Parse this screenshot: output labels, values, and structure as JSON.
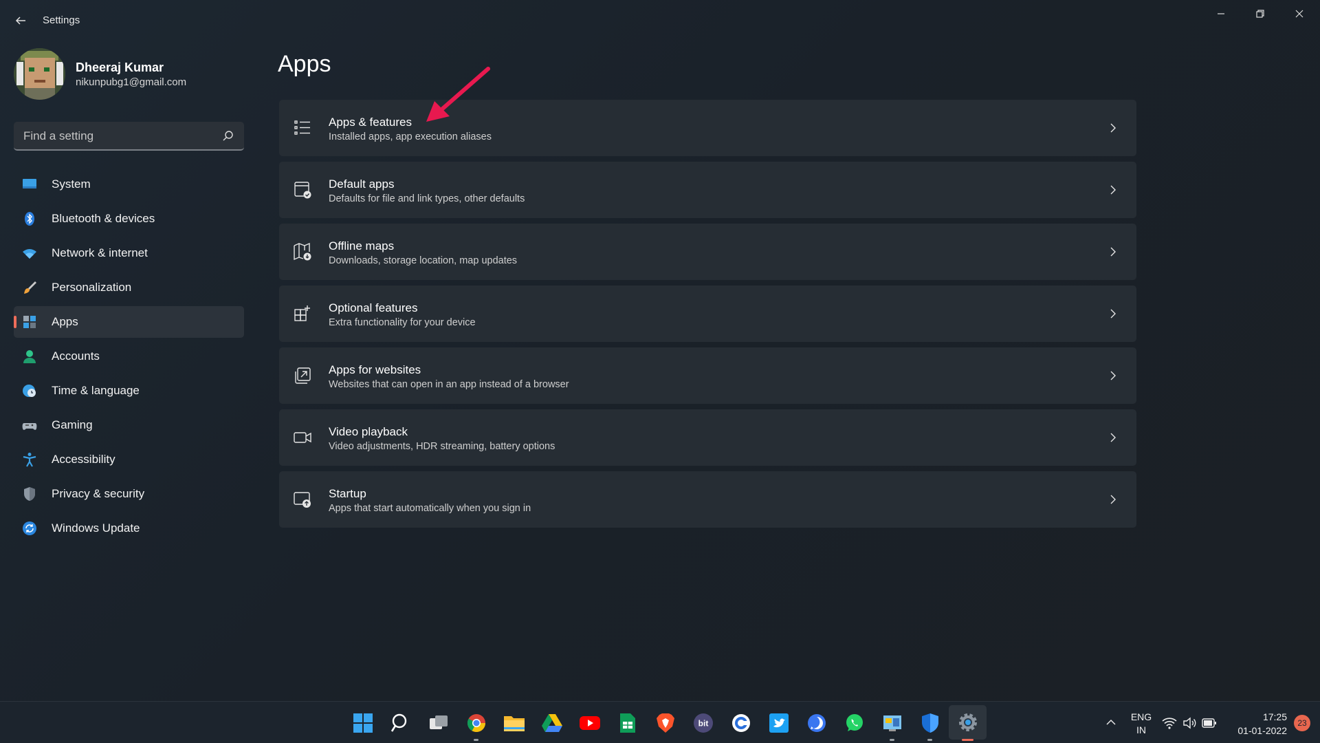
{
  "window": {
    "title": "Settings",
    "controls": [
      "minimize",
      "restore",
      "close"
    ]
  },
  "profile": {
    "name": "Dheeraj Kumar",
    "email": "nikunpubg1@gmail.com"
  },
  "search": {
    "placeholder": "Find a setting"
  },
  "sidebar": {
    "active": "Apps",
    "items": [
      {
        "label": "System",
        "icon": "monitor-icon"
      },
      {
        "label": "Bluetooth & devices",
        "icon": "bluetooth-icon"
      },
      {
        "label": "Network & internet",
        "icon": "wifi-icon"
      },
      {
        "label": "Personalization",
        "icon": "brush-icon"
      },
      {
        "label": "Apps",
        "icon": "apps-icon"
      },
      {
        "label": "Accounts",
        "icon": "person-icon"
      },
      {
        "label": "Time & language",
        "icon": "globe-clock-icon"
      },
      {
        "label": "Gaming",
        "icon": "gamepad-icon"
      },
      {
        "label": "Accessibility",
        "icon": "accessibility-icon"
      },
      {
        "label": "Privacy & security",
        "icon": "shield-icon"
      },
      {
        "label": "Windows Update",
        "icon": "update-icon"
      }
    ]
  },
  "main": {
    "title": "Apps",
    "cards": [
      {
        "title": "Apps & features",
        "subtitle": "Installed apps, app execution aliases",
        "icon": "list-icon"
      },
      {
        "title": "Default apps",
        "subtitle": "Defaults for file and link types, other defaults",
        "icon": "default-apps-icon"
      },
      {
        "title": "Offline maps",
        "subtitle": "Downloads, storage location, map updates",
        "icon": "map-icon"
      },
      {
        "title": "Optional features",
        "subtitle": "Extra functionality for your device",
        "icon": "grid-plus-icon"
      },
      {
        "title": "Apps for websites",
        "subtitle": "Websites that can open in an app instead of a browser",
        "icon": "open-external-icon"
      },
      {
        "title": "Video playback",
        "subtitle": "Video adjustments, HDR streaming, battery options",
        "icon": "video-camera-icon"
      },
      {
        "title": "Startup",
        "subtitle": "Apps that start automatically when you sign in",
        "icon": "startup-icon"
      }
    ]
  },
  "annotation": {
    "icon": "red-arrow-icon",
    "color": "#e8194f"
  },
  "taskbar": {
    "apps": [
      "windows-start-icon",
      "search-icon",
      "task-view-icon",
      "chrome-icon",
      "file-explorer-icon",
      "google-drive-icon",
      "youtube-icon",
      "google-sheets-icon",
      "brave-icon",
      "bit-icon",
      "cortana-icon",
      "twitter-icon",
      "signal-icon",
      "whatsapp-icon",
      "control-panel-icon",
      "defender-icon",
      "settings-gear-icon"
    ],
    "language": {
      "line1": "ENG",
      "line2": "IN"
    },
    "time": "17:25",
    "date": "01-01-2022",
    "notifications": "23"
  },
  "colors": {
    "accent": "#ee6d5a",
    "background": "#1b232b",
    "card": "#262d34"
  }
}
